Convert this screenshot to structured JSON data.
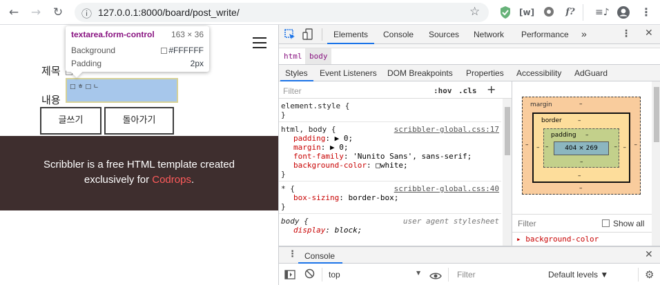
{
  "browser": {
    "url": "127.0.0.1:8000/board/post_write/",
    "nav": {
      "back": "←",
      "forward": "→",
      "reload": "↻",
      "info": "ⓘ",
      "star": "☆"
    },
    "extensions": [
      "shield",
      "web",
      "gear",
      "f?",
      "queue",
      "avatar",
      "menu"
    ]
  },
  "page": {
    "label_title": "제목",
    "label_content": "내용",
    "textarea_placeholder": "□ ㅎ □ ㄴ",
    "btn_write": "글쓰기",
    "btn_back": "돌아가기",
    "footer_line1": "Scribbler is a free HTML template created",
    "footer_line2_prefix": "exclusively for ",
    "footer_link": "Codrops",
    "footer_period": "."
  },
  "tooltip": {
    "selector": "textarea.form-control",
    "size": "163 × 36",
    "bg_label": "Background",
    "bg_value": "#FFFFFF",
    "pad_label": "Padding",
    "pad_value": "2px"
  },
  "devtools": {
    "tabs": [
      "Elements",
      "Console",
      "Sources",
      "Network",
      "Performance",
      "»"
    ],
    "active_tab": "Elements",
    "breadcrumb": [
      "html",
      "body"
    ],
    "subtabs": [
      "Styles",
      "Event Listeners",
      "DOM Breakpoints",
      "Properties",
      "Accessibility",
      "AdGuard"
    ],
    "filter_placeholder": "Filter",
    "hov": ":hov",
    "cls": ".cls",
    "plus": "+",
    "rules": [
      {
        "selector": "element.style {",
        "source": "",
        "props": [],
        "close": "}"
      },
      {
        "selector": "html, body {",
        "source": "scribbler-global.css:17",
        "props": [
          {
            "name": "padding",
            "value": "▶ 0;"
          },
          {
            "name": "margin",
            "value": "▶ 0;"
          },
          {
            "name": "font-family",
            "value": "'Nunito Sans', sans-serif;"
          },
          {
            "name": "background-color",
            "value": "□white;"
          }
        ],
        "close": "}"
      },
      {
        "selector": "* {",
        "source": "scribbler-global.css:40",
        "props": [
          {
            "name": "box-sizing",
            "value": "border-box;"
          }
        ],
        "close": "}"
      },
      {
        "selector": "body {",
        "source": "user agent stylesheet",
        "props": [
          {
            "name": "display",
            "value": "block;"
          }
        ],
        "close": ""
      }
    ],
    "boxmodel": {
      "margin": "margin",
      "margin_val": "–",
      "border": "border",
      "border_val": "–",
      "padding": "padding",
      "padding_val": "–",
      "content": "404 × 269"
    },
    "computed_filter": "Filter",
    "show_all": "Show all",
    "computed_prop": "▸ background-color",
    "drawer_tab": "Console",
    "console_context": "top",
    "console_filter": "Filter",
    "default_levels": "Default levels ▼"
  }
}
